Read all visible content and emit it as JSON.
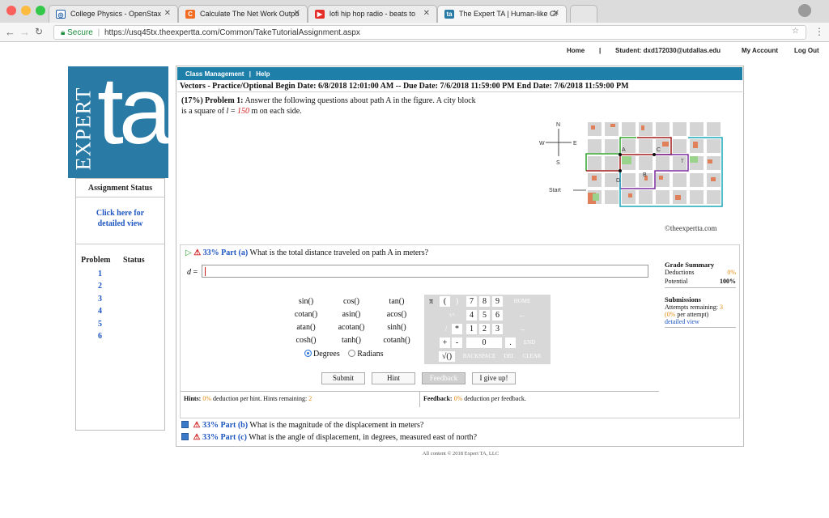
{
  "browser": {
    "tabs": [
      {
        "title": "College Physics - OpenStax",
        "icon": "openstax-icon"
      },
      {
        "title": "Calculate The Net Work Outpu",
        "icon": "chegg-icon"
      },
      {
        "title": "lofi hip hop radio - beats to",
        "icon": "youtube-icon"
      },
      {
        "title": "The Expert TA | Human-like Gr",
        "icon": "expertta-icon"
      }
    ],
    "secure_label": "Secure",
    "url": "https://usq45tx.theexpertta.com/Common/TakeTutorialAssignment.aspx"
  },
  "topnav": {
    "home": "Home",
    "separator": "|",
    "student": "Student: dxd172030@utdallas.edu",
    "my_account": "My Account",
    "log_out": "Log Out"
  },
  "logo": {
    "vertical_text": "EXPERT",
    "letters": "ta"
  },
  "sidebar": {
    "assignment_status": "Assignment Status",
    "click_here": "Click here for",
    "detailed_view": "detailed view",
    "problem_header": "Problem",
    "status_header": "Status",
    "problems": [
      "1",
      "2",
      "3",
      "4",
      "5",
      "6"
    ]
  },
  "header": {
    "class_management": "Class Management",
    "sep": "|",
    "help": "Help",
    "vectors_line": "Vectors - Practice/Optional Begin Date: 6/8/2018 12:01:00 AM -- Due Date: 7/6/2018 11:59:00 PM End Date: 7/6/2018 11:59:00 PM"
  },
  "problem": {
    "percent": "(17%)",
    "label": "Problem 1:",
    "text": "Answer the following questions about path A in the figure. A city block",
    "text2_prefix": "is a square of",
    "var": "l",
    "equals": "=",
    "value": "150",
    "text2_suffix": "m on each side.",
    "copyright": "©theexpertta.com"
  },
  "map": {
    "compass": {
      "n": "N",
      "s": "S",
      "e": "E",
      "w": "W"
    },
    "labels": {
      "a": "A",
      "b": "B",
      "c": "C",
      "d": "D",
      "t": "T",
      "start": "Start"
    }
  },
  "part_a": {
    "percent": "33%",
    "part": "Part (a)",
    "question": "What is the total distance traveled on path A in meters?",
    "var": "d",
    "eq": "="
  },
  "grade_summary": {
    "title": "Grade Summary",
    "deductions_label": "Deductions",
    "deductions_value": "0%",
    "potential_label": "Potential",
    "potential_value": "100%",
    "submissions_title": "Submissions",
    "attempts_label": "Attempts remaining:",
    "attempts_value": "3",
    "per_attempt_value": "(0%",
    "per_attempt_label": "per attempt)",
    "detailed_view": "detailed view"
  },
  "calculator": {
    "funcs": [
      [
        "sin()",
        "cos()",
        "tan()"
      ],
      [
        "cotan()",
        "asin()",
        "acos()"
      ],
      [
        "atan()",
        "acotan()",
        "sinh()"
      ],
      [
        "cosh()",
        "tanh()",
        "cotanh()"
      ]
    ],
    "pi": "π",
    "lparen": "(",
    "rparen": ")",
    "digits": [
      "7",
      "8",
      "9",
      "4",
      "5",
      "6",
      "1",
      "2",
      "3"
    ],
    "zero": "0",
    "dot": ".",
    "plus": "+",
    "minus": "-",
    "star": "*",
    "slash": "/",
    "sqrt": "√()",
    "up": "↑^",
    "upcaret": "^↓",
    "home": "HOME",
    "end": "END",
    "backspace": "BACKSPACE",
    "del": "DEL",
    "clear": "CLEAR",
    "left": "←",
    "right": "→",
    "degrees": "Degrees",
    "radians": "Radians"
  },
  "buttons": {
    "submit": "Submit",
    "hint": "Hint",
    "feedback": "Feedback",
    "give_up": "I give up!"
  },
  "hints": {
    "label": "Hints:",
    "pct": "0%",
    "text": "deduction per hint. Hints remaining:",
    "remaining": "2"
  },
  "feedback": {
    "label": "Feedback:",
    "pct": "0%",
    "text": "deduction per feedback."
  },
  "part_b": {
    "percent": "33%",
    "part": "Part (b)",
    "question": "What is the magnitude of the displacement in meters?"
  },
  "part_c": {
    "percent": "33%",
    "part": "Part (c)",
    "question": "What is the angle of displacement, in degrees, measured east of north?"
  },
  "footer": "All content © 2018 Expert TA, LLC"
}
